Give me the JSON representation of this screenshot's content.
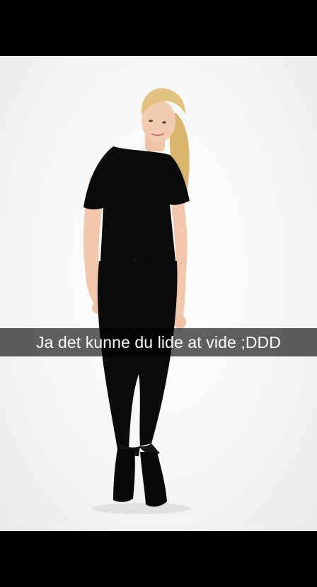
{
  "caption": {
    "text": "Ja det kunne du lide at vide ;DDD"
  },
  "colors": {
    "frame_background": "#000000",
    "photo_background": "#f4f4f4",
    "caption_bar": "rgba(0,0,0,0.62)",
    "caption_text": "#ffffff",
    "outfit": "#0b0b0b",
    "hair": "#e2c27e",
    "skin": "#f3cbb1"
  }
}
